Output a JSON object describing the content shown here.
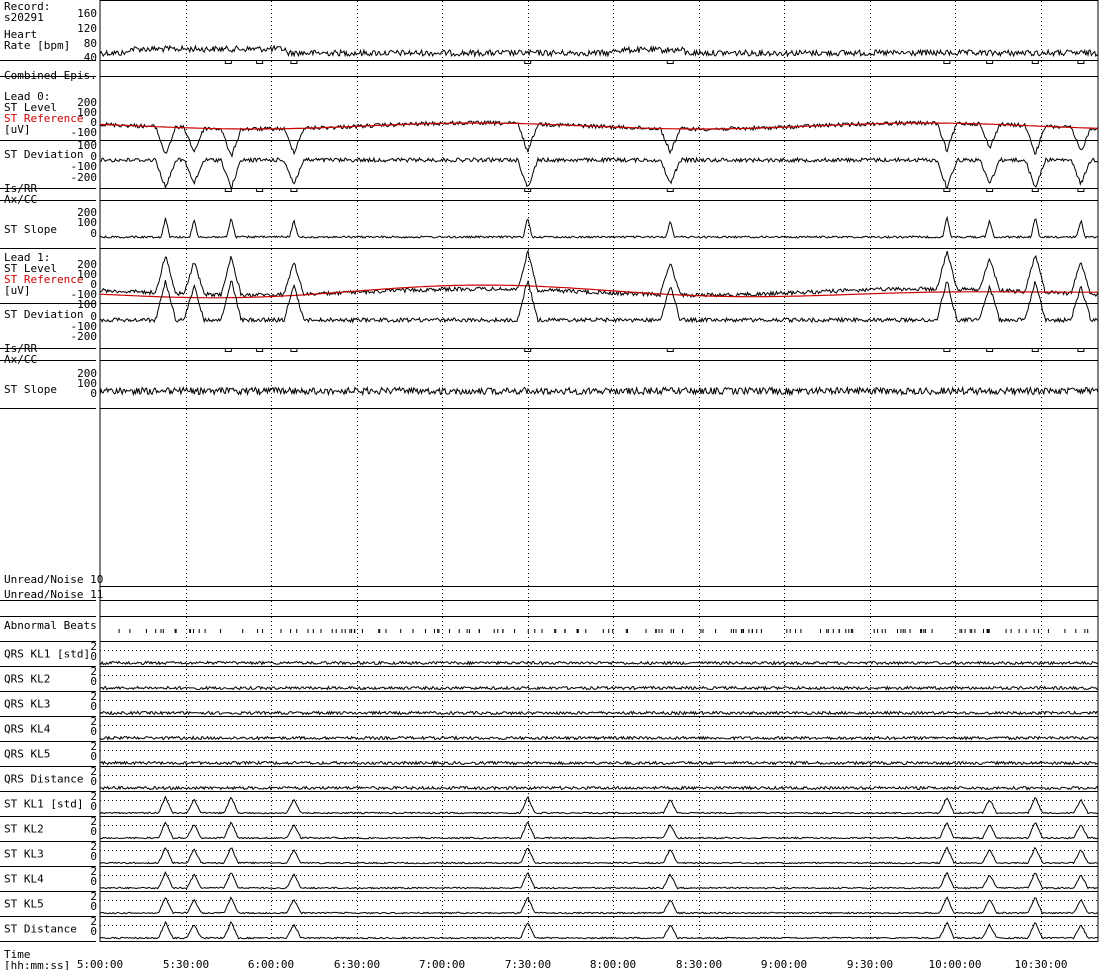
{
  "header": {
    "record_label": "Record:",
    "record_id": "s20291"
  },
  "colors": {
    "trace": "#000000",
    "reference": "#cc0000",
    "grid": "#000000"
  },
  "chart_data": {
    "type": "line",
    "x_axis": {
      "label_line1": "Time",
      "label_line2": "[hh:mm:ss]",
      "start": "5:00:00",
      "end": "10:50:00",
      "ticks": [
        "5:00:00",
        "5:30:00",
        "6:00:00",
        "6:30:00",
        "7:00:00",
        "7:30:00",
        "8:00:00",
        "8:30:00",
        "9:00:00",
        "9:30:00",
        "10:00:00",
        "10:30:00"
      ],
      "minor_grid_minutes": 30
    },
    "grid": "dotted-vertical",
    "rows": [
      {
        "id": "hr",
        "labels": [
          "Heart",
          "Rate [bpm]"
        ],
        "ticks": [
          "160",
          "120",
          "80",
          "40"
        ],
        "kind": "hr",
        "baseline": 70
      },
      {
        "id": "epis",
        "labels": [
          "Combined Epis."
        ],
        "kind": "markers"
      },
      {
        "id": "l0_level",
        "labels": [
          "Lead 0:",
          "ST Level",
          "ST Reference",
          "[uV]"
        ],
        "ticks": [
          "200",
          "100",
          "0",
          "-100"
        ],
        "kind": "st_level",
        "lead": 0,
        "has_reference": true
      },
      {
        "id": "l0_dev",
        "labels": [
          "ST Deviation"
        ],
        "ticks": [
          "100",
          "0",
          "-100",
          "-200"
        ],
        "kind": "st_dev",
        "lead": 0
      },
      {
        "id": "l0_isrr",
        "labels": [
          "Is/RR",
          "Ax/CC"
        ],
        "kind": "markers"
      },
      {
        "id": "l0_slope",
        "labels": [
          "ST Slope"
        ],
        "ticks": [
          "200",
          "100",
          "0"
        ],
        "kind": "slope",
        "lead": 0
      },
      {
        "id": "l1_level",
        "labels": [
          "Lead 1:",
          "ST Level",
          "ST Reference",
          "[uV]"
        ],
        "ticks": [
          "200",
          "100",
          "0",
          "-100"
        ],
        "kind": "st_level",
        "lead": 1,
        "has_reference": true
      },
      {
        "id": "l1_dev",
        "labels": [
          "ST Deviation"
        ],
        "ticks": [
          "100",
          "0",
          "-100",
          "-200"
        ],
        "kind": "st_dev",
        "lead": 1
      },
      {
        "id": "l1_isrr",
        "labels": [
          "Is/RR",
          "Ax/CC"
        ],
        "kind": "markers"
      },
      {
        "id": "l1_slope",
        "labels": [
          "ST Slope"
        ],
        "ticks": [
          "200",
          "100",
          "0"
        ],
        "kind": "slope",
        "lead": 1
      },
      {
        "id": "blank",
        "labels": [],
        "kind": "blank"
      },
      {
        "id": "noise10",
        "labels": [
          "Unread/Noise 10"
        ],
        "kind": "blank"
      },
      {
        "id": "noise11",
        "labels": [
          "Unread/Noise 11"
        ],
        "kind": "blank"
      },
      {
        "id": "abn",
        "labels": [
          "Abnormal Beats"
        ],
        "kind": "beats"
      },
      {
        "id": "qkl1",
        "labels": [
          "QRS KL1 [std]"
        ],
        "ticks": [
          "2",
          "0"
        ],
        "kind": "kl"
      },
      {
        "id": "qkl2",
        "labels": [
          "QRS KL2"
        ],
        "ticks": [
          "2",
          "0"
        ],
        "kind": "kl"
      },
      {
        "id": "qkl3",
        "labels": [
          "QRS KL3"
        ],
        "ticks": [
          "2",
          "0"
        ],
        "kind": "kl"
      },
      {
        "id": "qkl4",
        "labels": [
          "QRS KL4"
        ],
        "ticks": [
          "2",
          "0"
        ],
        "kind": "kl"
      },
      {
        "id": "qkl5",
        "labels": [
          "QRS KL5"
        ],
        "ticks": [
          "2",
          "0"
        ],
        "kind": "kl"
      },
      {
        "id": "qdist",
        "labels": [
          "QRS Distance"
        ],
        "ticks": [
          "2",
          "0"
        ],
        "kind": "kl"
      },
      {
        "id": "skl1",
        "labels": [
          "ST KL1 [std]"
        ],
        "ticks": [
          "2",
          "0"
        ],
        "kind": "kl_st"
      },
      {
        "id": "skl2",
        "labels": [
          "ST KL2"
        ],
        "ticks": [
          "2",
          "0"
        ],
        "kind": "kl_st"
      },
      {
        "id": "skl3",
        "labels": [
          "ST KL3"
        ],
        "ticks": [
          "2",
          "0"
        ],
        "kind": "kl_st"
      },
      {
        "id": "skl4",
        "labels": [
          "ST KL4"
        ],
        "ticks": [
          "2",
          "0"
        ],
        "kind": "kl_st"
      },
      {
        "id": "skl5",
        "labels": [
          "ST KL5"
        ],
        "ticks": [
          "2",
          "0"
        ],
        "kind": "kl_st"
      },
      {
        "id": "sdist",
        "labels": [
          "ST Distance"
        ],
        "ticks": [
          "2",
          "0"
        ],
        "kind": "kl_st"
      }
    ],
    "episode_times": [
      "5:45:00",
      "5:56:00",
      "6:08:00",
      "7:30:00",
      "8:20:00",
      "9:57:00",
      "10:12:00",
      "10:28:00",
      "10:44:00"
    ],
    "st_spike_times": [
      "5:23:00",
      "5:33:00",
      "5:46:00",
      "6:08:00",
      "7:30:00",
      "8:20:00",
      "9:57:00",
      "10:12:00",
      "10:28:00",
      "10:44:00"
    ]
  }
}
